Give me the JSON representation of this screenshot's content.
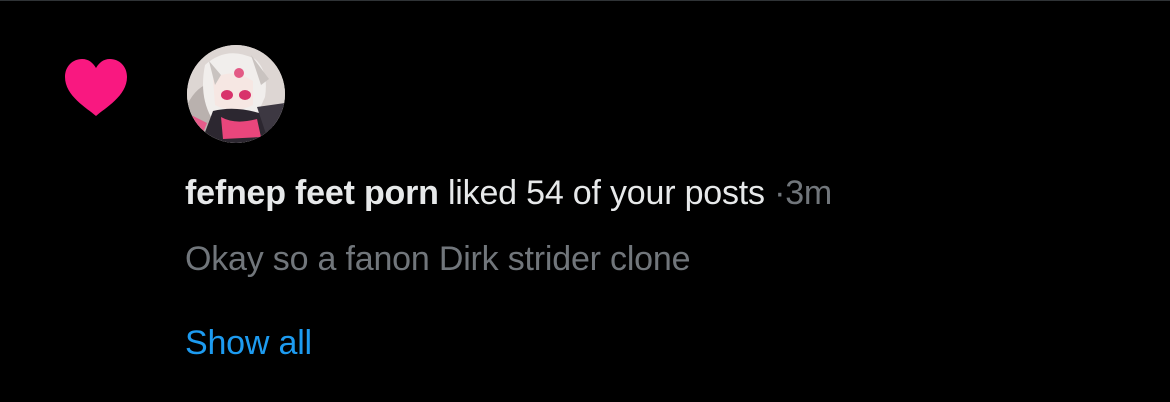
{
  "notification": {
    "icon": "heart-icon",
    "icon_color": "#f91880",
    "avatar": "user-avatar",
    "user_name": "fefnep feet porn",
    "action_text": "liked 54 of your posts",
    "separator": "·",
    "time": "3m",
    "post_preview": "Okay so a fanon Dirk strider clone",
    "show_all_label": "Show all"
  },
  "colors": {
    "background": "#000000",
    "primary_text": "#e7e9ea",
    "secondary_text": "#71767b",
    "link": "#1d9bf0"
  }
}
